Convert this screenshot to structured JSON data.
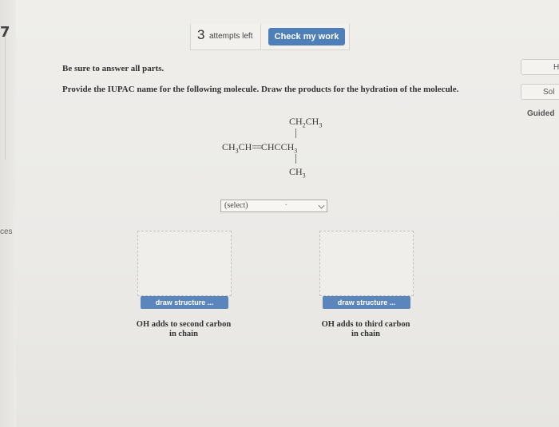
{
  "left_margin": {
    "text": "ces"
  },
  "attempts": {
    "count": "3",
    "label": "attempts left"
  },
  "check_button": {
    "label": "Check my work"
  },
  "side_buttons": {
    "h_label": "H",
    "sol_label": "Sol",
    "guided_label": "Guided"
  },
  "instructions": {
    "line1": "Be sure to answer all parts.",
    "line2": "Provide the IUPAC name for the following molecule. Draw the products for the hydration of the molecule."
  },
  "molecule": {
    "top_sub": {
      "base": "CH",
      "s1": "2",
      "mid": "CH",
      "s2": "3"
    },
    "main": {
      "p1": "CH",
      "s1": "3",
      "p2": "CH",
      "p3": "CHCCH",
      "s2": "3"
    },
    "bottom_sub": {
      "base": "CH",
      "s1": "3"
    }
  },
  "name_select": {
    "selected": "(select)"
  },
  "draw_areas": [
    {
      "button": "draw structure ...",
      "caption_l1": "OH adds to second carbon",
      "caption_l2": "in chain"
    },
    {
      "button": "draw structure ...",
      "caption_l1": "OH adds to third carbon",
      "caption_l2": "in chain"
    }
  ]
}
